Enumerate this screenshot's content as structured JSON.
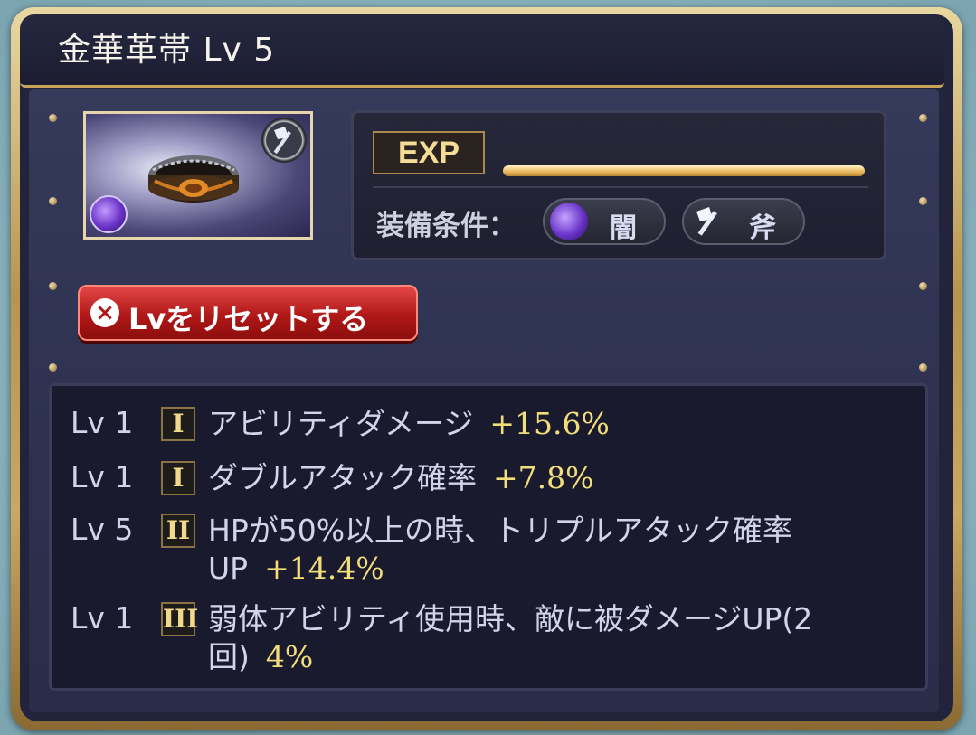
{
  "item": {
    "name": "金華革帯",
    "level": "Lv 5"
  },
  "exp": {
    "label": "EXP",
    "progress": 1.0
  },
  "equip": {
    "label": "装備条件：",
    "element": "闇",
    "weapon": "斧"
  },
  "reset_button": {
    "label": "Lvをリセットする"
  },
  "skills": [
    {
      "lv": "Lv 1",
      "tier": "I",
      "desc": "アビリティダメージ",
      "value": "+15.6%"
    },
    {
      "lv": "Lv 1",
      "tier": "I",
      "desc": "ダブルアタック確率",
      "value": "+7.8%"
    },
    {
      "lv": "Lv 5",
      "tier": "II",
      "desc": "HPが50%以上の時、トリプルアタック確率UP",
      "value": "+14.4%"
    },
    {
      "lv": "Lv 1",
      "tier": "III",
      "desc": "弱体アビリティ使用時、敵に被ダメージUP(2回)",
      "value": "4%"
    }
  ],
  "colors": {
    "accent_gold": "#f1dd7a",
    "reset_red": "#b01818",
    "dark_element": "#6a34c8"
  },
  "icons": {
    "weapon": "axe-icon",
    "element": "dark-element-icon",
    "reset": "close-circle-icon"
  }
}
